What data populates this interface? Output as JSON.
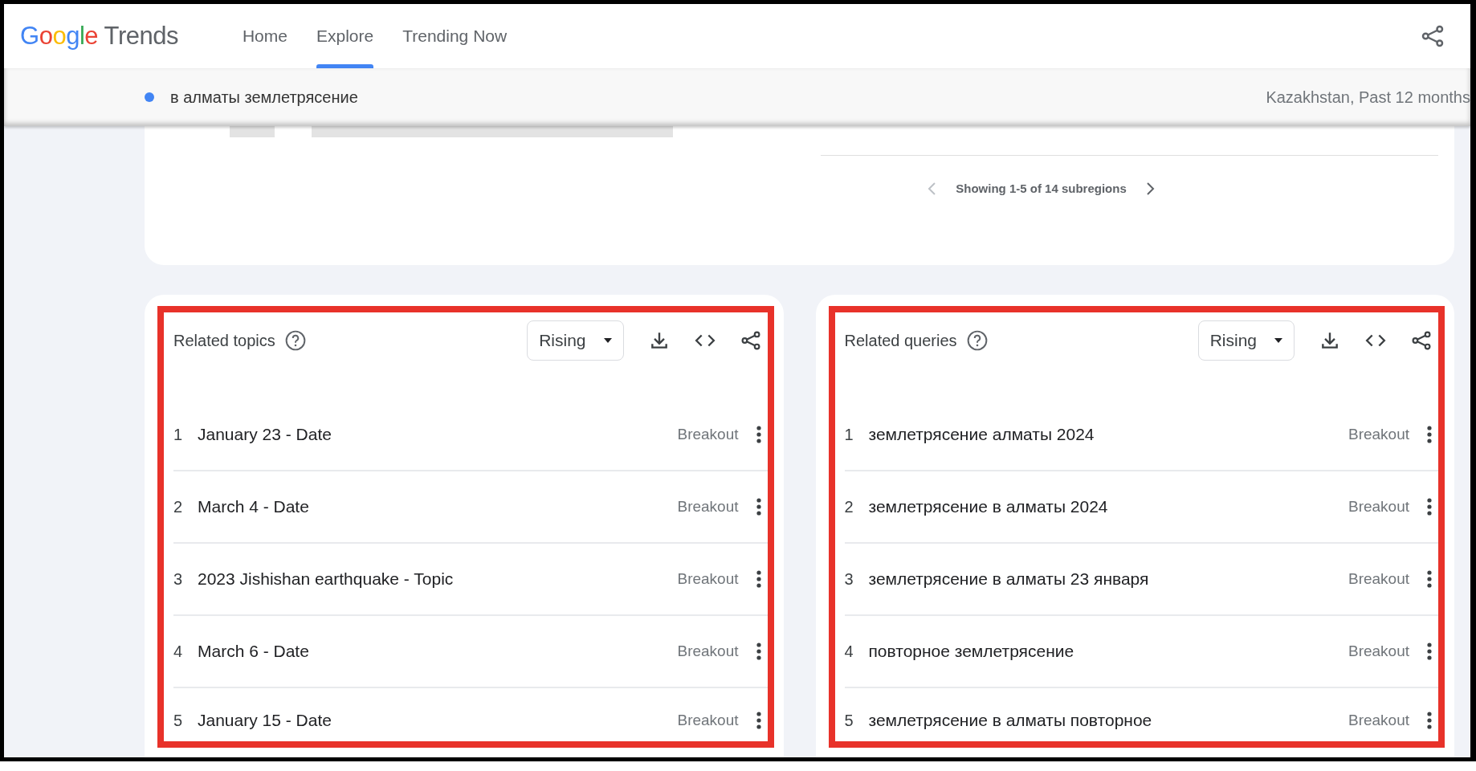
{
  "header": {
    "logo": "Google Trends",
    "tabs": [
      {
        "label": "Home",
        "selected": false
      },
      {
        "label": "Explore",
        "selected": true
      },
      {
        "label": "Trending Now",
        "selected": false
      }
    ]
  },
  "search_bar": {
    "term": "в алматы землетрясение",
    "color": "#4285f4",
    "filter": "Kazakhstan, Past 12 months"
  },
  "map_panel": {
    "pager": "Showing 1-5 of 14 subregions",
    "previous_disabled": true,
    "next_disabled": false
  },
  "panels": [
    {
      "title": "Related topics",
      "highlighted": true,
      "dropdown": "Rising",
      "rows": [
        {
          "rank": "1",
          "label": "January 23 - Date",
          "value": "Breakout"
        },
        {
          "rank": "2",
          "label": "March 4 - Date",
          "value": "Breakout"
        },
        {
          "rank": "3",
          "label": "2023 Jishishan earthquake - Topic",
          "value": "Breakout"
        },
        {
          "rank": "4",
          "label": "March 6 - Date",
          "value": "Breakout"
        },
        {
          "rank": "5",
          "label": "January 15 - Date",
          "value": "Breakout"
        }
      ]
    },
    {
      "title": "Related queries",
      "highlighted": true,
      "dropdown": "Rising",
      "rows": [
        {
          "rank": "1",
          "label": "землетрясение алматы 2024",
          "value": "Breakout"
        },
        {
          "rank": "2",
          "label": "землетрясение в алматы 2024",
          "value": "Breakout"
        },
        {
          "rank": "3",
          "label": "землетрясение в алматы 23 января",
          "value": "Breakout"
        },
        {
          "rank": "4",
          "label": "повторное землетрясение",
          "value": "Breakout"
        },
        {
          "rank": "5",
          "label": "землетрясение в алматы повторное",
          "value": "Breakout"
        }
      ]
    }
  ]
}
